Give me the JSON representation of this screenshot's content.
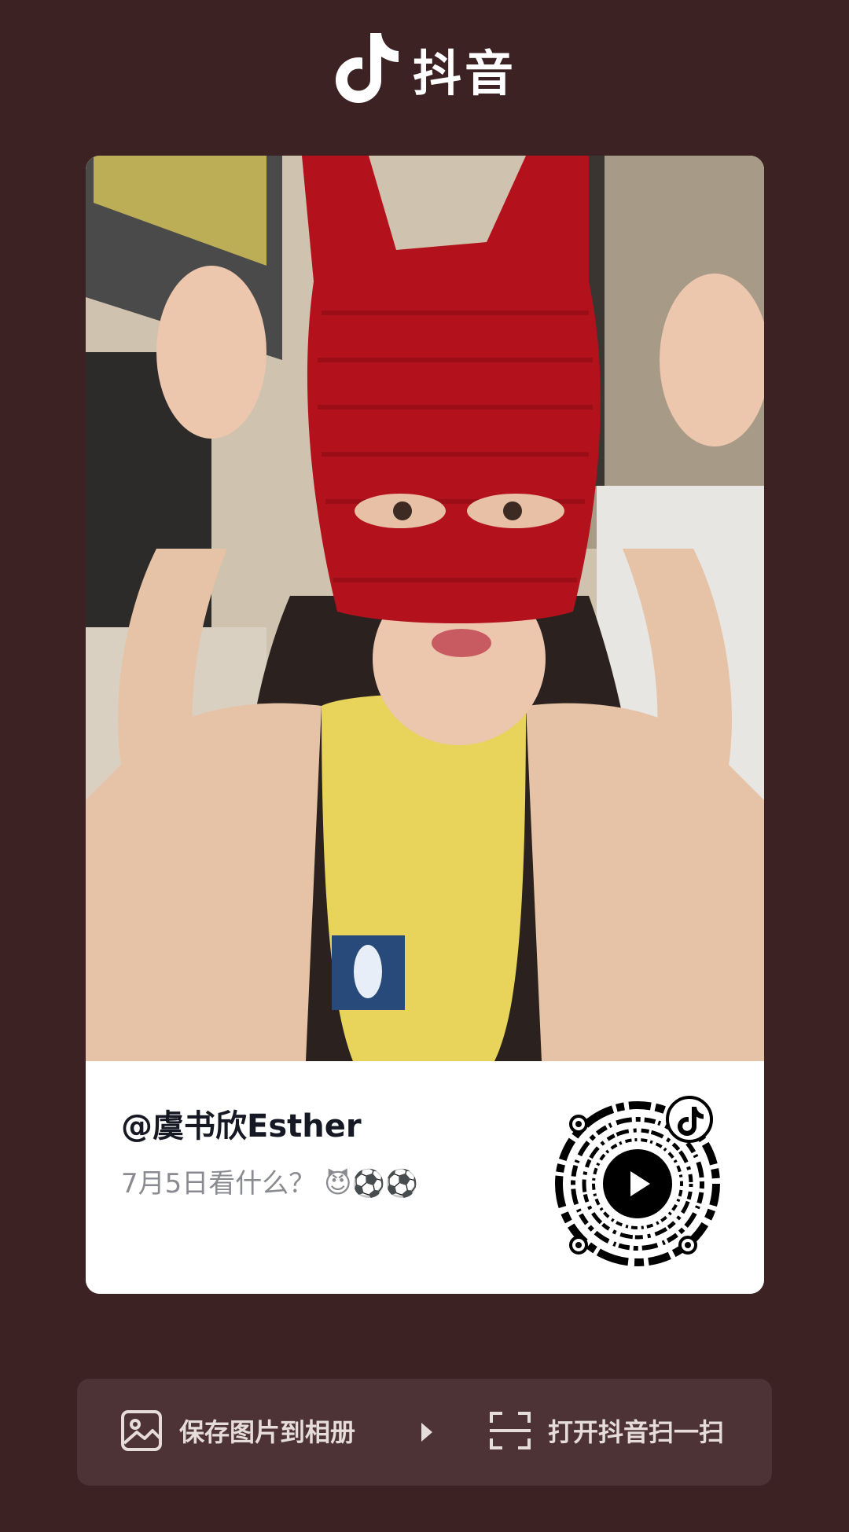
{
  "app": {
    "name": "抖音",
    "logo_icon": "douyin-note-icon"
  },
  "post": {
    "username": "@虞书欣Esther",
    "caption": "7月5日看什么？ 😈⚽⚽",
    "photo_description_icon": "photo"
  },
  "qr": {
    "icon": "qr-code-icon",
    "center_icon": "play-icon",
    "badge_icon": "douyin-note-icon"
  },
  "actions": {
    "save_label": "保存图片到相册",
    "save_icon": "image-icon",
    "scan_label": "打开抖音扫一扫",
    "scan_icon": "scan-icon",
    "divider_icon": "triangle-right-icon"
  },
  "colors": {
    "background": "#3d2224",
    "card": "#ffffff",
    "action_bar": "#4d3335",
    "username": "#161823",
    "caption": "#8a8b91",
    "accent_cyan": "#25f4ee",
    "accent_red": "#fe2c55"
  }
}
